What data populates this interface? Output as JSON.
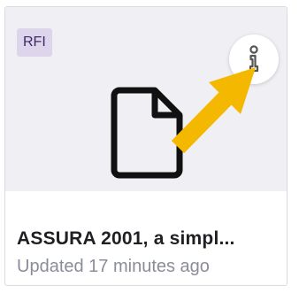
{
  "card": {
    "type_badge": "RFI",
    "title": "ASSURA 2001, a simpl...",
    "subtitle": "Updated 17 minutes ago",
    "thumbnail_icon": "document-icon",
    "info_icon": "info-icon",
    "annotation": "arrow-pointer-icon"
  },
  "colors": {
    "thumbnail_bg": "#f0f0f4",
    "badge_bg": "#ddd5ec",
    "badge_text": "#3f2a66",
    "arrow": "#f5b800",
    "title_text": "#1f1f24",
    "subtitle_text": "#8a8d99"
  }
}
